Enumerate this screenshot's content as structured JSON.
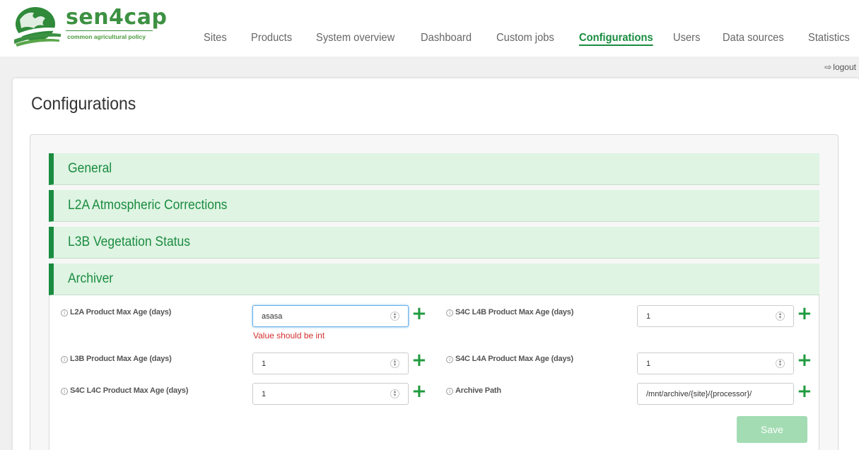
{
  "brand": {
    "name": "sen4cap",
    "tagline": "common agricultural policy"
  },
  "nav": {
    "items": [
      {
        "label": "Sites"
      },
      {
        "label": "Products"
      },
      {
        "label": "System overview"
      },
      {
        "label": "Dashboard"
      },
      {
        "label": "Custom jobs"
      },
      {
        "label": "Configurations",
        "active": true
      },
      {
        "label": "Users"
      },
      {
        "label": "Data sources"
      },
      {
        "label": "Statistics"
      }
    ]
  },
  "logout": {
    "label": "logout",
    "icon": "logout-icon"
  },
  "page": {
    "title": "Configurations"
  },
  "sections": [
    {
      "title": "General"
    },
    {
      "title": "L2A Atmospheric Corrections"
    },
    {
      "title": "L3B Vegetation Status"
    },
    {
      "title": "Archiver",
      "expanded": true
    }
  ],
  "archiver": {
    "fields": [
      {
        "label": "L2A Product Max Age (days)",
        "value": "asasa",
        "error": "Value should be int"
      },
      {
        "label": "S4C L4B Product Max Age (days)",
        "value": "1"
      },
      {
        "label": "L3B Product Max Age (days)",
        "value": "1"
      },
      {
        "label": "S4C L4A Product Max Age (days)",
        "value": "1"
      },
      {
        "label": "S4C L4C Product Max Age (days)",
        "value": "1"
      },
      {
        "label": "Archive Path",
        "value": "/mnt/archive/{site}/{processor}/"
      }
    ],
    "info_icon": "info-icon",
    "add_icon": "plus-icon",
    "save_label": "Save"
  },
  "colors": {
    "brand_green": "#1a8c40",
    "section_bg": "#dff4e3",
    "error_red": "#d32f2f",
    "save_disabled": "#a3dcb3"
  }
}
